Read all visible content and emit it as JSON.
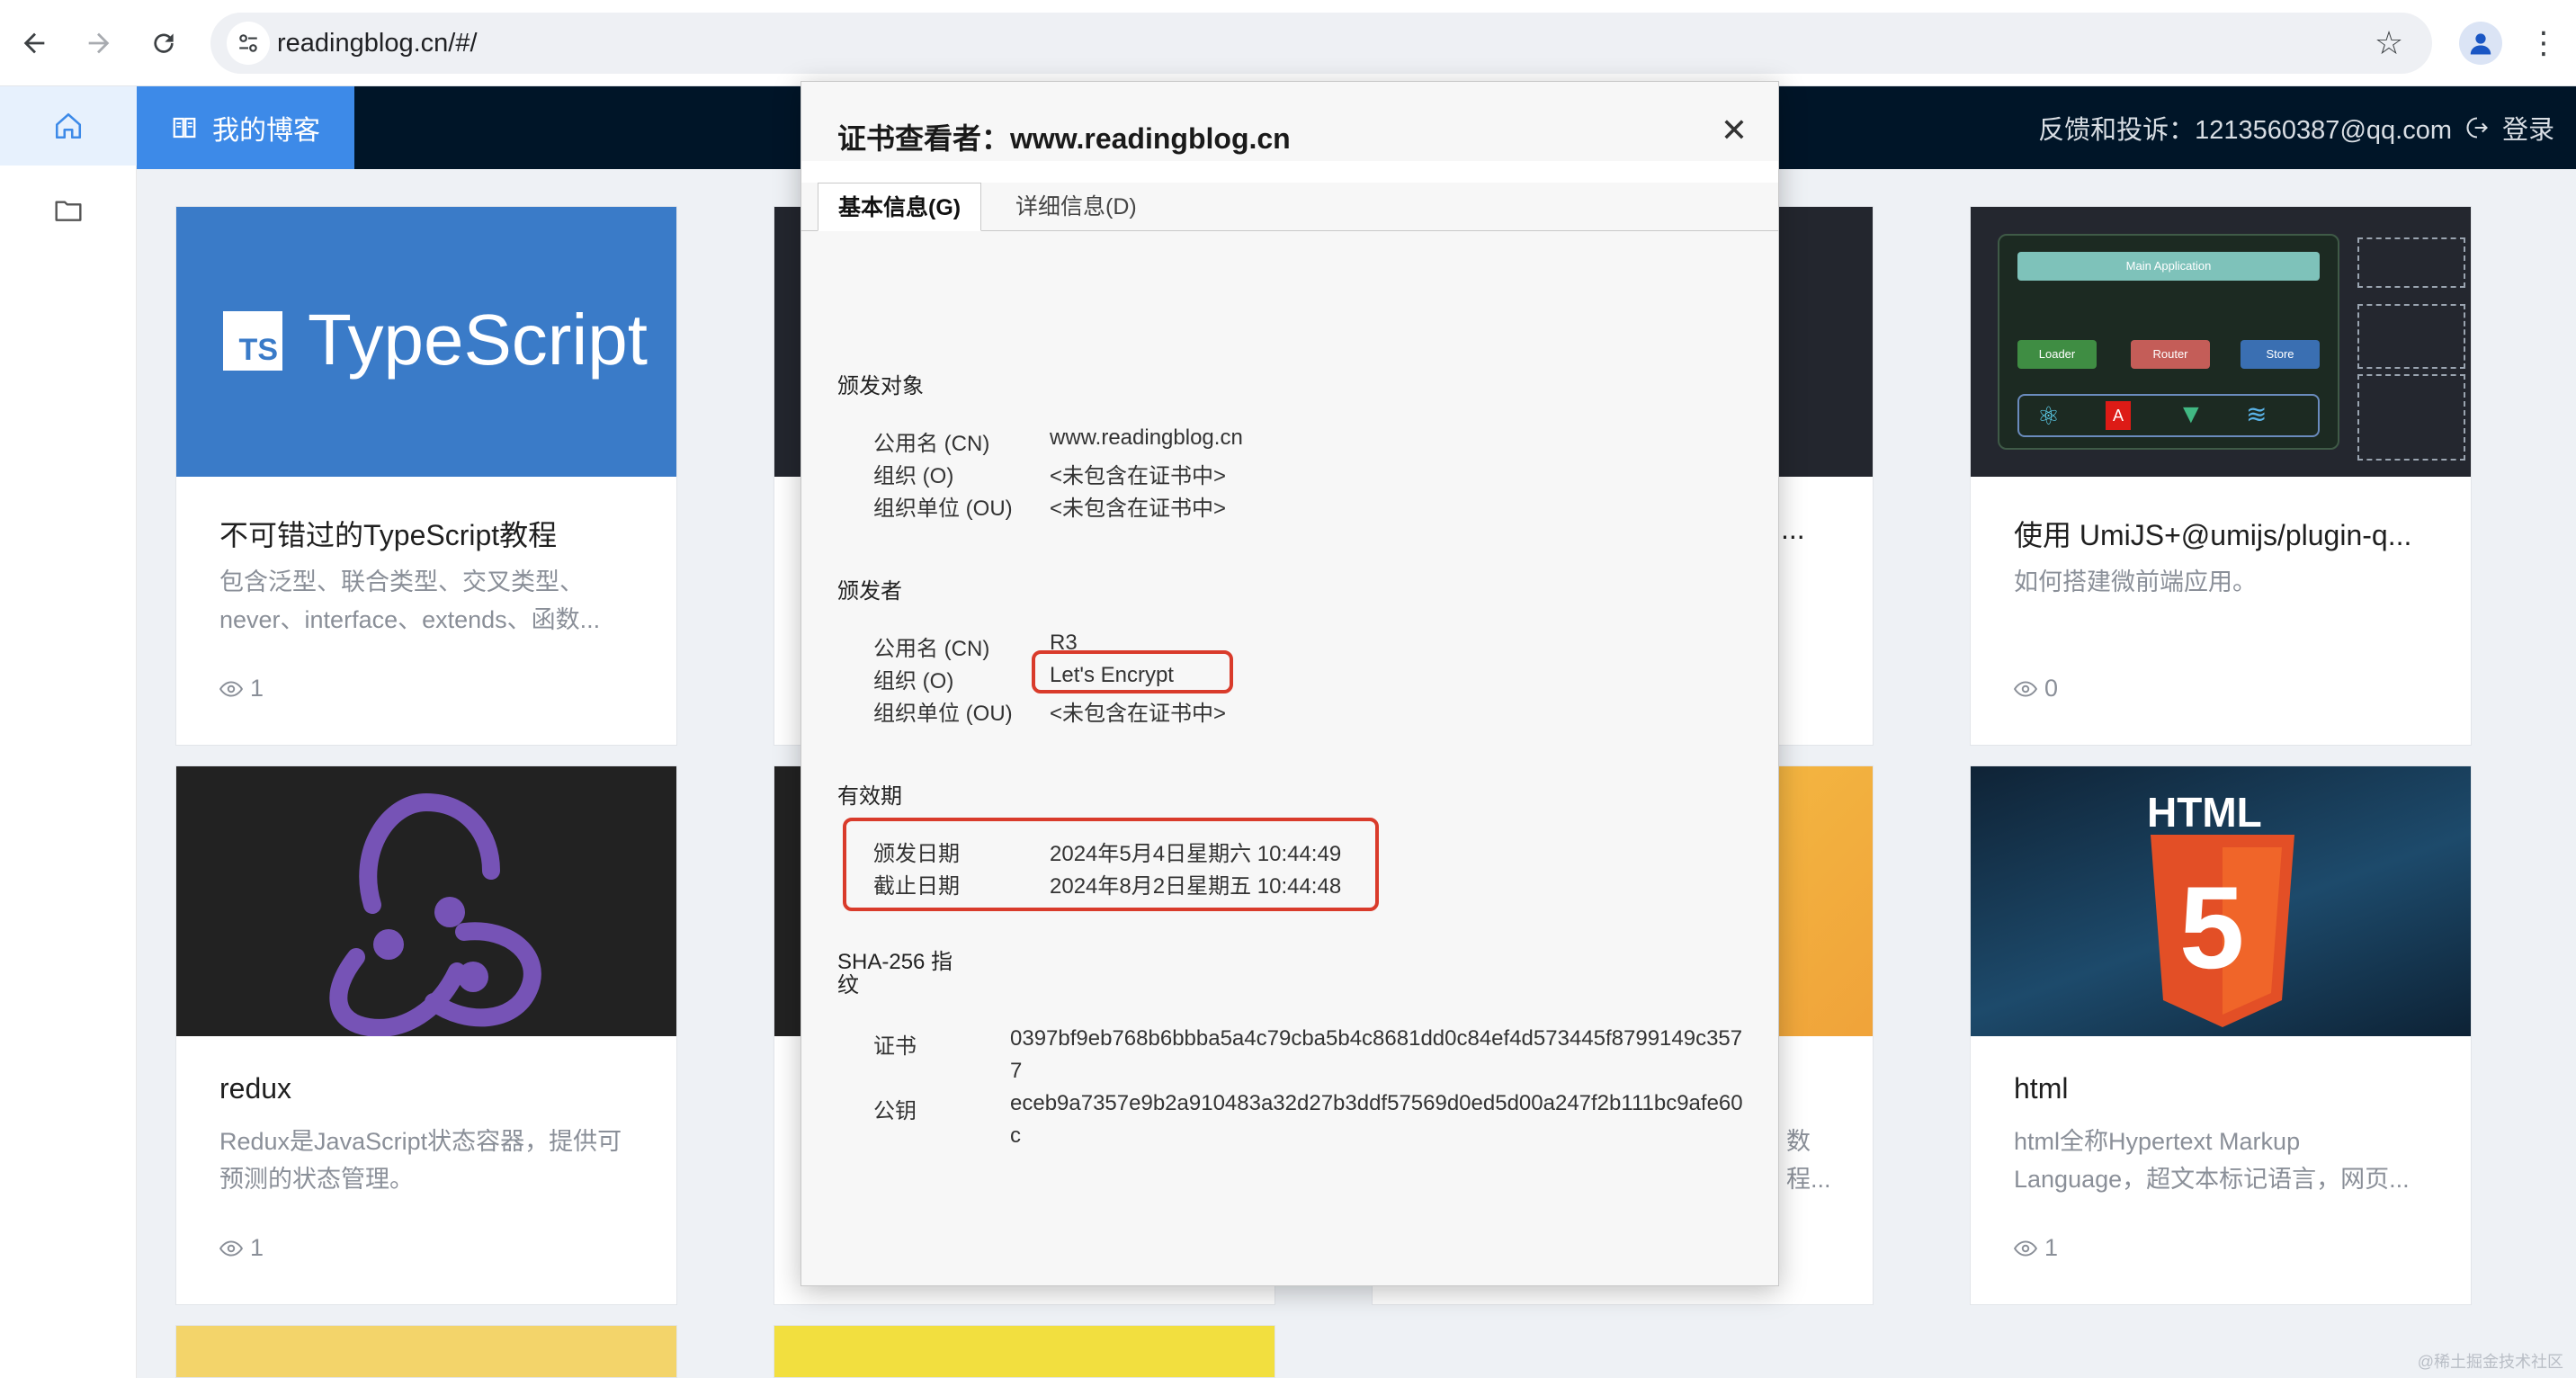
{
  "browser": {
    "url": "readingblog.cn/#/"
  },
  "header": {
    "brand": "我的博客",
    "feedback": "反馈和投诉：1213560387@qq.com",
    "login": "登录"
  },
  "cards": [
    {
      "thumb_text": "TypeScript",
      "thumb_badge": "TS",
      "title": "不可错过的TypeScript教程",
      "desc": "包含泛型、联合类型、交叉类型、never、interface、extends、函数...",
      "views": "1"
    },
    {
      "title": "使用 UmiJS+@umijs/plugin-q...",
      "desc": "如何搭建微前端应用。",
      "views": "0",
      "diagram": {
        "main": "Main Application",
        "loader": "Loader",
        "router": "Router",
        "store": "Store"
      }
    },
    {
      "title": "redux",
      "desc": "Redux是JavaScript状态容器，提供可预测的状态管理。",
      "views": "1"
    },
    {
      "thumb_text": "HTML",
      "thumb_badge": "5",
      "title": "html",
      "desc": "html全称Hypertext Markup Language，超文本标记语言，网页...",
      "views": "1"
    }
  ],
  "partial": {
    "mid_title": "...",
    "mid_desc_1": "数",
    "mid_desc_2": "程..."
  },
  "dialog": {
    "title": "证书查看者：www.readingblog.cn",
    "tabs": {
      "basic": "基本信息(G)",
      "detail": "详细信息(D)"
    },
    "issued_to": {
      "heading": "颁发对象",
      "cn_label": "公用名 (CN)",
      "cn": "www.readingblog.cn",
      "o_label": "组织 (O)",
      "o": "<未包含在证书中>",
      "ou_label": "组织单位 (OU)",
      "ou": "<未包含在证书中>"
    },
    "issuer": {
      "heading": "颁发者",
      "cn_label": "公用名 (CN)",
      "cn": "R3",
      "o_label": "组织 (O)",
      "o": "Let's Encrypt",
      "ou_label": "组织单位 (OU)",
      "ou": "<未包含在证书中>"
    },
    "validity": {
      "heading": "有效期",
      "issued_label": "颁发日期",
      "issued": "2024年5月4日星期六 10:44:49",
      "expires_label": "截止日期",
      "expires": "2024年8月2日星期五 10:44:48"
    },
    "fingerprints": {
      "heading_1": "SHA-256 指",
      "heading_2": "纹",
      "cert_label": "证书",
      "cert": "0397bf9eb768b6bbba5a4c79cba5b4c8681dd0c84ef4d573445f8799149c3577",
      "key_label": "公钥",
      "key": "eceb9a7357e9b2a910483a32d27b3ddf57569d0ed5d00a247f2b111bc9afe60c"
    }
  },
  "watermark": "@稀土掘金技术社区",
  "colors": {
    "highlight": "#d93b2b",
    "brand_blue": "#3d8ae8",
    "header_bg": "#001528"
  }
}
